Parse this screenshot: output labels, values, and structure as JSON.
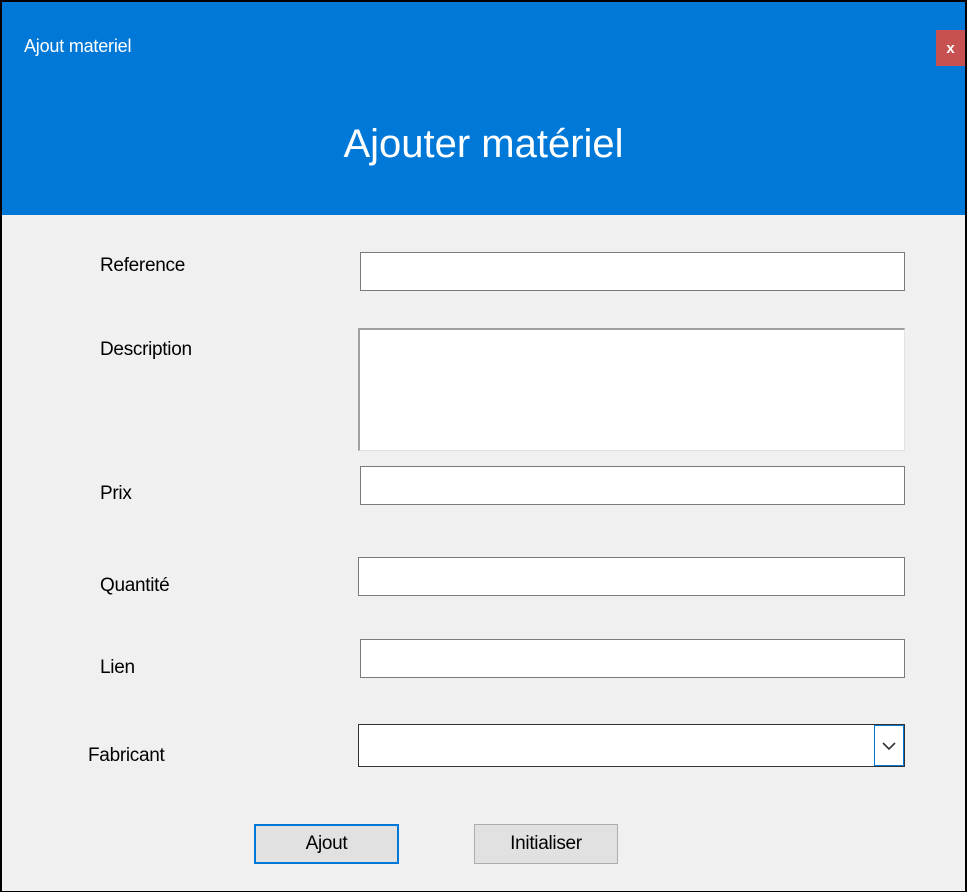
{
  "window": {
    "title": "Ajout materiel",
    "close_label": "x"
  },
  "header": {
    "heading": "Ajouter matériel"
  },
  "form": {
    "reference": {
      "label": "Reference",
      "value": ""
    },
    "description": {
      "label": "Description",
      "value": ""
    },
    "prix": {
      "label": "Prix",
      "value": ""
    },
    "quantite": {
      "label": "Quantité",
      "value": ""
    },
    "lien": {
      "label": "Lien",
      "value": ""
    },
    "fabricant": {
      "label": "Fabricant",
      "selected": ""
    }
  },
  "buttons": {
    "ajout": "Ajout",
    "initialiser": "Initialiser"
  },
  "colors": {
    "accent": "#0078d7",
    "close": "#c75050",
    "background": "#f0f0f0"
  }
}
